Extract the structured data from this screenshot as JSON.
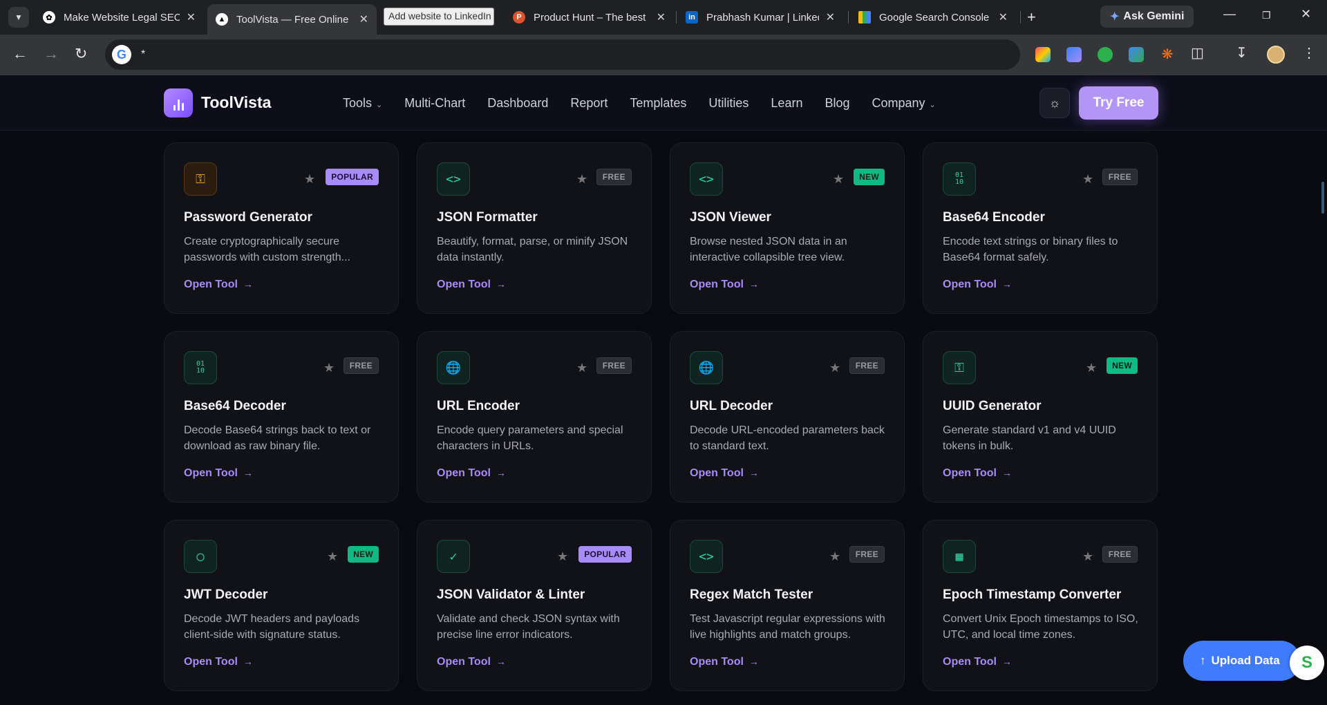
{
  "browser": {
    "tabs": [
      {
        "title": "Make Website Legal SEO",
        "favicon": "chatgpt-icon"
      },
      {
        "title": "ToolVista — Free Online",
        "favicon": "vercel-icon",
        "active": true
      },
      {
        "title": "Product Hunt – The best",
        "favicon": "producthunt-icon"
      },
      {
        "title": "Prabhash Kumar | Linked",
        "favicon": "linkedin-icon"
      },
      {
        "title": "Google Search Console",
        "favicon": "search-console-icon"
      }
    ],
    "tooltip": "Add website to LinkedIn",
    "gemini_label": "Ask Gemini",
    "address": "*"
  },
  "header": {
    "brand": "ToolVista",
    "nav": [
      {
        "label": "Tools",
        "dropdown": true
      },
      {
        "label": "Multi-Chart"
      },
      {
        "label": "Dashboard"
      },
      {
        "label": "Report"
      },
      {
        "label": "Templates"
      },
      {
        "label": "Utilities"
      },
      {
        "label": "Learn"
      },
      {
        "label": "Blog"
      },
      {
        "label": "Company",
        "dropdown": true
      }
    ],
    "cta": "Try Free"
  },
  "tools": [
    {
      "title": "Password Generator",
      "desc": "Create cryptographically secure passwords with custom strength...",
      "badge": "POPULAR",
      "icon": "key-icon",
      "color": "orange",
      "link": "Open Tool"
    },
    {
      "title": "JSON Formatter",
      "desc": "Beautify, format, parse, or minify JSON data instantly.",
      "badge": "FREE",
      "icon": "code-icon",
      "color": "green",
      "link": "Open Tool"
    },
    {
      "title": "JSON Viewer",
      "desc": "Browse nested JSON data in an interactive collapsible tree view.",
      "badge": "NEW",
      "icon": "code-icon",
      "color": "green",
      "link": "Open Tool"
    },
    {
      "title": "Base64 Encoder",
      "desc": "Encode text strings or binary files to Base64 format safely.",
      "badge": "FREE",
      "icon": "binary-icon",
      "color": "green",
      "link": "Open Tool"
    },
    {
      "title": "Base64 Decoder",
      "desc": "Decode Base64 strings back to text or download as raw binary file.",
      "badge": "FREE",
      "icon": "binary-icon",
      "color": "green",
      "link": "Open Tool"
    },
    {
      "title": "URL Encoder",
      "desc": "Encode query parameters and special characters in URLs.",
      "badge": "FREE",
      "icon": "globe-icon",
      "color": "green",
      "link": "Open Tool"
    },
    {
      "title": "URL Decoder",
      "desc": "Decode URL-encoded parameters back to standard text.",
      "badge": "FREE",
      "icon": "globe-icon",
      "color": "green",
      "link": "Open Tool"
    },
    {
      "title": "UUID Generator",
      "desc": "Generate standard v1 and v4 UUID tokens in bulk.",
      "badge": "NEW",
      "icon": "key-icon",
      "color": "green",
      "link": "Open Tool"
    },
    {
      "title": "JWT Decoder",
      "desc": "Decode JWT headers and payloads client-side with signature status.",
      "badge": "NEW",
      "icon": "shield-icon",
      "color": "green",
      "link": "Open Tool"
    },
    {
      "title": "JSON Validator & Linter",
      "desc": "Validate and check JSON syntax with precise line error indicators.",
      "badge": "POPULAR",
      "icon": "check-icon",
      "color": "green",
      "link": "Open Tool"
    },
    {
      "title": "Regex Match Tester",
      "desc": "Test Javascript regular expressions with live highlights and match groups.",
      "badge": "FREE",
      "icon": "code-icon",
      "color": "green",
      "link": "Open Tool"
    },
    {
      "title": "Epoch Timestamp Converter",
      "desc": "Convert Unix Epoch timestamps to ISO, UTC, and local time zones.",
      "badge": "FREE",
      "icon": "calendar-icon",
      "color": "green",
      "link": "Open Tool"
    }
  ],
  "upload_label": "Upload Data",
  "colors": {
    "accent": "#a98bf5",
    "cta": "#b395f5",
    "new_badge": "#10b981",
    "upload": "#3f7bff"
  }
}
